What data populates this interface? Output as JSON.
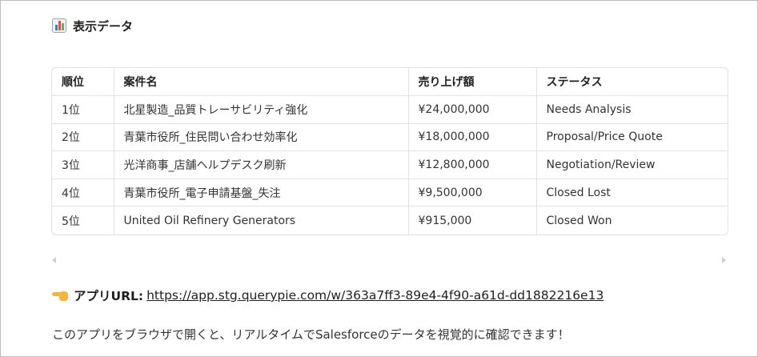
{
  "heading": {
    "icon": "bar-chart-icon",
    "text": "表示データ"
  },
  "table": {
    "headers": [
      "順位",
      "案件名",
      "売り上げ額",
      "ステータス"
    ],
    "rows": [
      [
        "1位",
        "北星製造_品質トレーサビリティ強化",
        "¥24,000,000",
        "Needs Analysis"
      ],
      [
        "2位",
        "青葉市役所_住民問い合わせ効率化",
        "¥18,000,000",
        "Proposal/Price Quote"
      ],
      [
        "3位",
        "光洋商事_店舗ヘルプデスク刷新",
        "¥12,800,000",
        "Negotiation/Review"
      ],
      [
        "4位",
        "青葉市役所_電子申請基盤_失注",
        "¥9,500,000",
        "Closed Lost"
      ],
      [
        "5位",
        "United Oil Refinery Generators",
        "¥915,000",
        "Closed Won"
      ]
    ]
  },
  "app_url": {
    "icon": "pointing-hand-icon",
    "label": "アプリURL:",
    "link": "https://app.stg.querypie.com/w/363a7ff3-89e4-4f90-a61d-dd1882216e13"
  },
  "footer": {
    "text": "このアプリをブラウザで開くと、リアルタイムでSalesforceのデータを視覚的に確認できます！"
  }
}
